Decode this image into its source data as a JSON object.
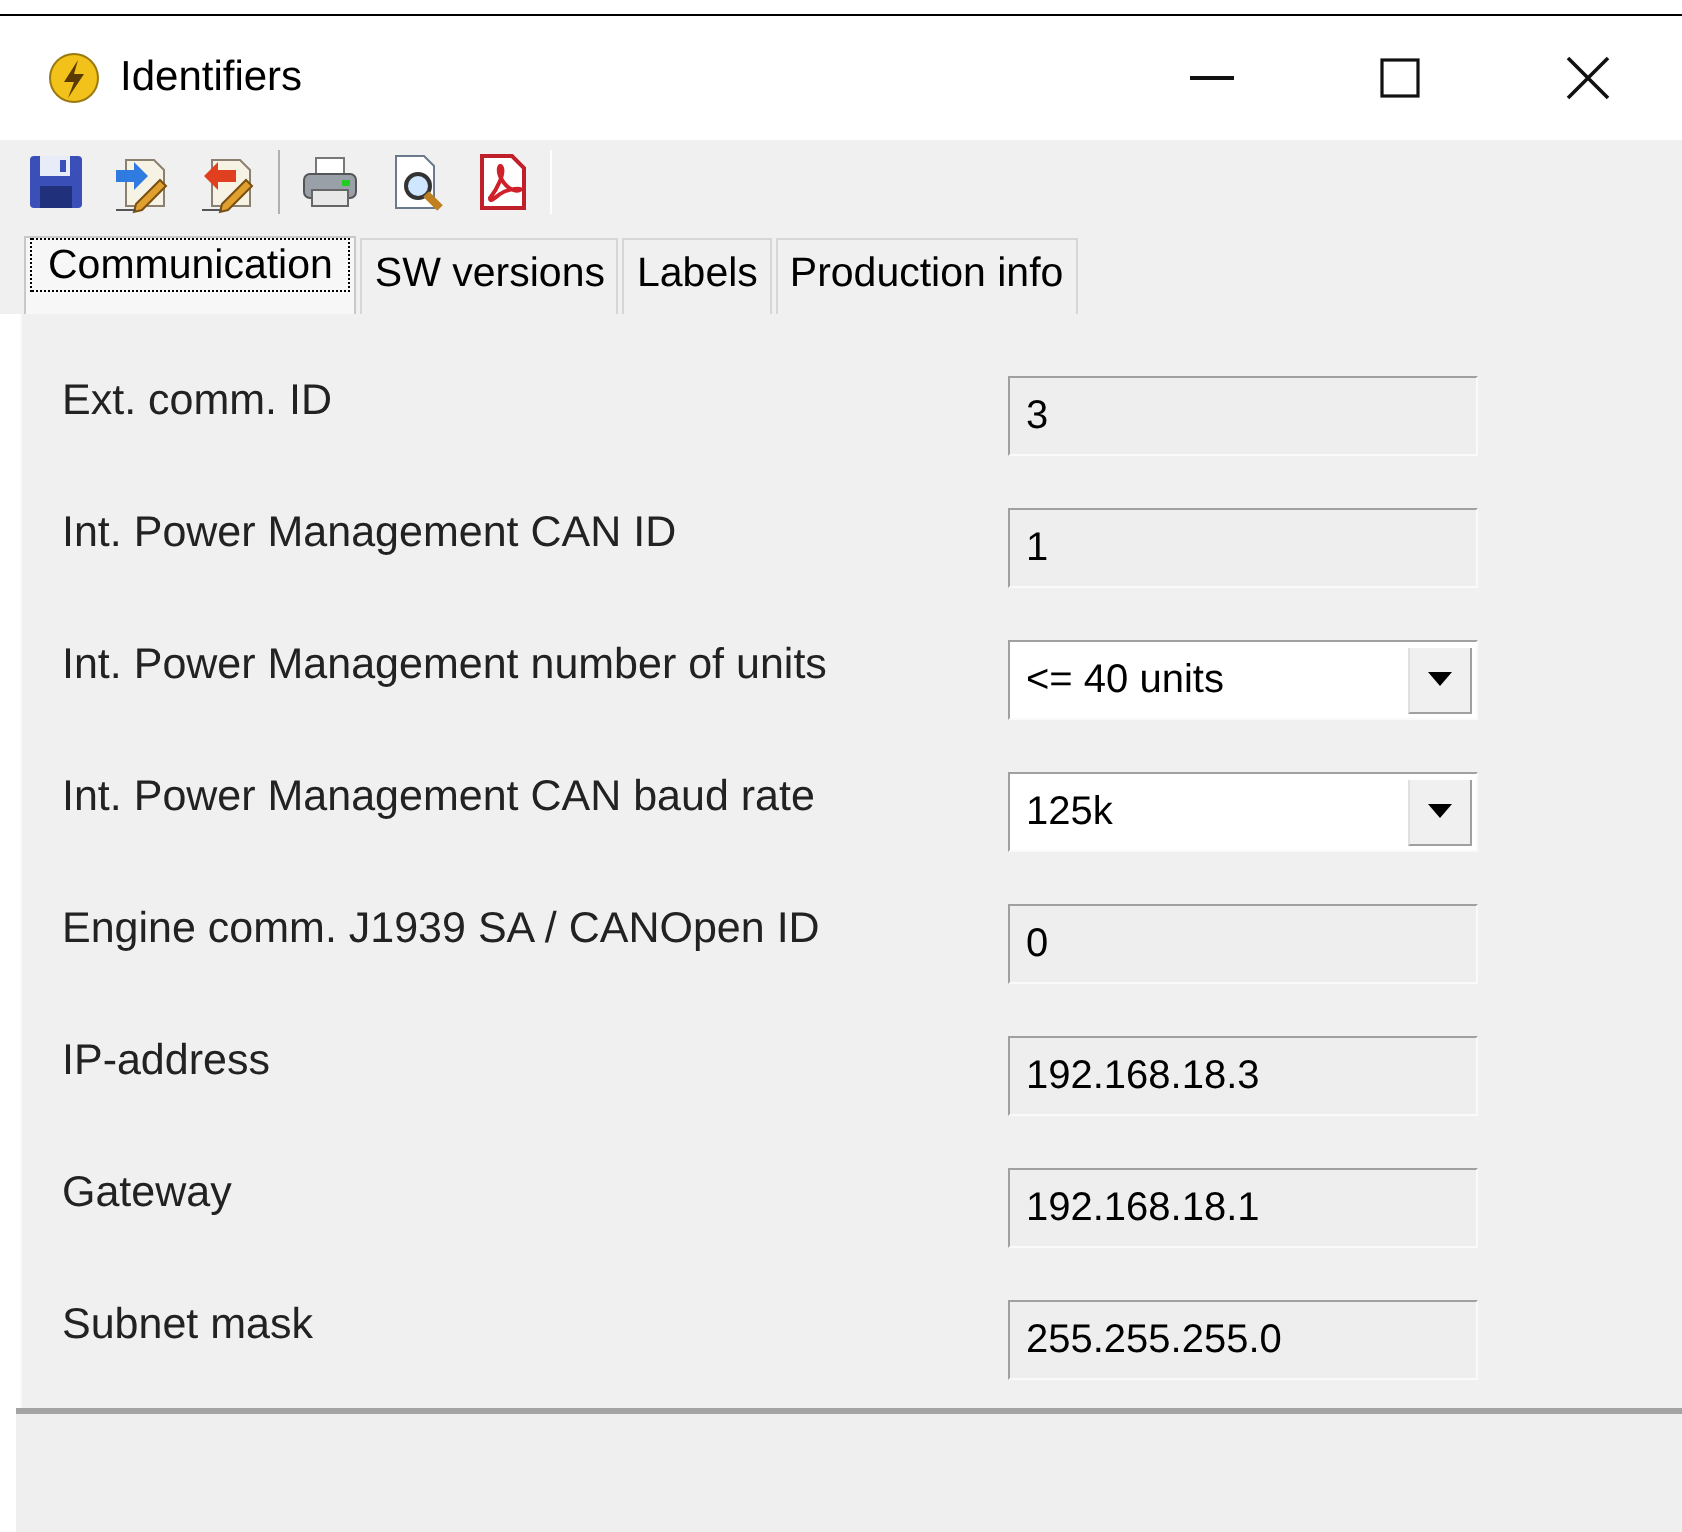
{
  "window": {
    "title": "Identifiers"
  },
  "tabs": [
    {
      "label": "Communication",
      "selected": true
    },
    {
      "label": "SW versions",
      "selected": false
    },
    {
      "label": "Labels",
      "selected": false
    },
    {
      "label": "Production info",
      "selected": false
    }
  ],
  "fields": [
    {
      "label": "Ext. comm. ID",
      "kind": "text",
      "value": "3"
    },
    {
      "label": "Int. Power Management CAN ID",
      "kind": "text",
      "value": "1"
    },
    {
      "label": "Int. Power Management number of units",
      "kind": "dropdown",
      "value": "<= 40 units"
    },
    {
      "label": "Int. Power Management CAN baud rate",
      "kind": "dropdown",
      "value": "125k"
    },
    {
      "label": "Engine comm. J1939 SA / CANOpen ID",
      "kind": "text",
      "value": "0"
    },
    {
      "label": "IP-address",
      "kind": "text",
      "value": "192.168.18.3"
    },
    {
      "label": "Gateway",
      "kind": "text",
      "value": "192.168.18.1"
    },
    {
      "label": "Subnet mask",
      "kind": "text",
      "value": "255.255.255.0"
    }
  ]
}
